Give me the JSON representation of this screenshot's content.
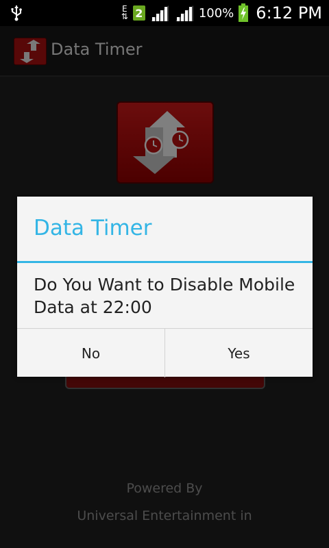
{
  "status_bar": {
    "network_type": "E",
    "sim_slot": "2",
    "battery_percent": "100%",
    "time": "6:12 PM"
  },
  "action_bar": {
    "title": "Data Timer"
  },
  "main": {
    "powered_by": "Powered By",
    "company": "Universal Entertainment in"
  },
  "dialog": {
    "title": "Data Timer",
    "message": "Do You Want to Disable Mobile Data at 22:00",
    "no_label": "No",
    "yes_label": "Yes"
  },
  "colors": {
    "accent": "#33b5e5",
    "brand_red": "#a01010",
    "background": "#1e1e1e"
  },
  "icons": [
    "usb-icon",
    "network-e-icon",
    "sim-2-icon",
    "signal-icon",
    "signal-icon-2",
    "battery-charging-icon",
    "app-logo-icon",
    "alarm-clock-arrows-icon"
  ]
}
